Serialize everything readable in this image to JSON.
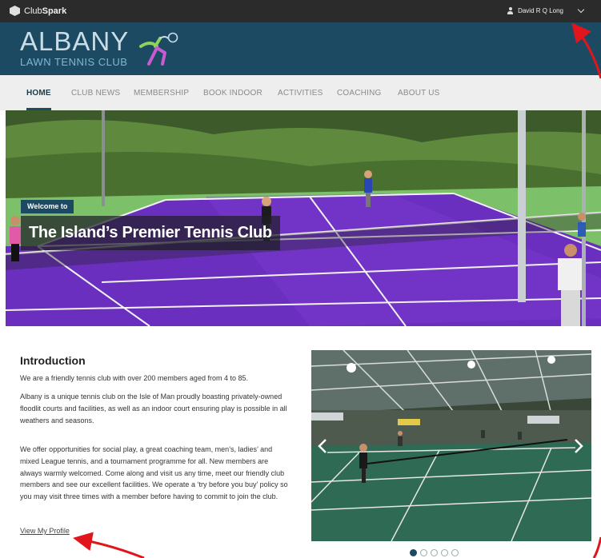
{
  "topbar": {
    "brand_light": "Club",
    "brand_bold": "Spark",
    "user_name": "David R Q Long"
  },
  "header": {
    "brand_name": "ALBANY",
    "brand_sub": "LAWN TENNIS CLUB"
  },
  "nav": {
    "items": [
      "HOME",
      "CLUB NEWS",
      "MEMBERSHIP",
      "BOOK INDOOR",
      "ACTIVITIES",
      "COACHING",
      "ABOUT US"
    ],
    "active": "HOME"
  },
  "hero": {
    "tag": "Welcome to",
    "title": "The Island’s Premier Tennis Club"
  },
  "intro": {
    "heading": "Introduction",
    "paragraphs": [
      "We are a friendly tennis club with over 200 members aged from 4 to 85.",
      "Albany is a unique tennis club on the Isle of Man proudly boasting privately-owned floodlit courts and facilities, as well as an indoor court ensuring play is possible in all weathers and seasons.",
      "We offer opportunities for social play, a great coaching team, men’s, ladies’ and mixed League tennis, and a tournament programme for all. New members are always warmly welcomed. Come along and visit us any time, meet our friendly club members and see our excellent facilities. We operate a ‘try before you buy’ policy so you may visit three times with a member before having to commit to join the club."
    ],
    "profile_link": "View My Profile"
  },
  "carousel": {
    "slide_count": 5,
    "active_index": 0
  },
  "colors": {
    "topbar": "#2b2b2b",
    "header": "#1c4a63",
    "nav_bg": "#eeeeee",
    "court_purple": "#6b2fc0",
    "court_green": "#7dc06a",
    "annotation_arrow": "#e0161c"
  }
}
